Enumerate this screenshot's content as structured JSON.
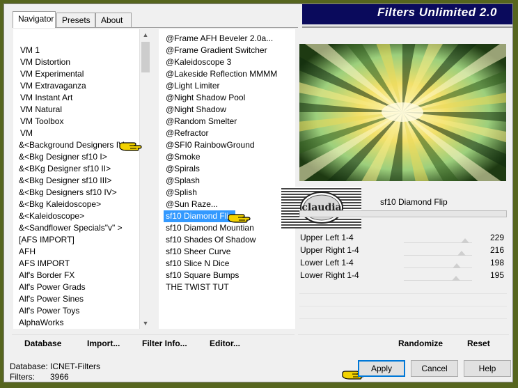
{
  "title": "Filters Unlimited 2.0",
  "tabs": [
    {
      "label": "Navigator",
      "active": true
    },
    {
      "label": "Presets",
      "active": false
    },
    {
      "label": "About",
      "active": false
    }
  ],
  "categories": [
    "VM 1",
    "VM Distortion",
    "VM Experimental",
    "VM Extravaganza",
    "VM Instant Art",
    "VM Natural",
    "VM Toolbox",
    "VM",
    "&<Background Designers IV>",
    "&<Bkg Designer sf10 I>",
    "&<BKg Designer sf10 II>",
    "&<Bkg Designer sf10 III>",
    "&<Bkg Designers sf10 IV>",
    "&<Bkg Kaleidoscope>",
    "&<Kaleidoscope>",
    "&<Sandflower Specials\"v\" >",
    "[AFS IMPORT]",
    "AFH",
    "AFS IMPORT",
    "Alf's Border FX",
    "Alf's Power Grads",
    "Alf's Power Sines",
    "Alf's Power Toys",
    "AlphaWorks"
  ],
  "filters": [
    "@Frame AFH Beveler 2.0a...",
    "@Frame Gradient Switcher",
    "@Kaleidoscope 3",
    "@Lakeside Reflection MMMM",
    "@Light Limiter",
    "@Night Shadow Pool",
    "@Night Shadow",
    "@Random Smelter",
    "@Refractor",
    "@SFI0 RainbowGround",
    "@Smoke",
    "@Spirals",
    "@Splash",
    "@Splish",
    "@Sun Raze...",
    "sf10 Diamond Flip",
    "sf10 Diamond Mountian",
    "sf10 Shades Of Shadow",
    "sf10 Sheer Curve",
    "sf10 Slice N Dice",
    "sf10 Square Bumps",
    "THE TWIST TUT"
  ],
  "selected_category_index": 8,
  "selected_filter_index": 15,
  "filter_name": "sf10 Diamond Flip",
  "logo_text": "claudia",
  "params": [
    {
      "label": "Upper Left 1-4",
      "value": "229",
      "level": 229
    },
    {
      "label": "Upper Right 1-4",
      "value": "216",
      "level": 216
    },
    {
      "label": "Lower Left 1-4",
      "value": "198",
      "level": 198
    },
    {
      "label": "Lower Right 1-4",
      "value": "195",
      "level": 195
    }
  ],
  "toolbar": {
    "database": "Database",
    "import": "Import...",
    "filter_info": "Filter Info...",
    "editor": "Editor...",
    "randomize": "Randomize",
    "reset": "Reset"
  },
  "status": {
    "database_label": "Database:",
    "database_value": "ICNET-Filters",
    "filters_label": "Filters:",
    "filters_value": "3966"
  },
  "buttons": {
    "apply": "Apply",
    "cancel": "Cancel",
    "help": "Help"
  },
  "colors": {
    "frame": "#56651e",
    "banner": "#0a0a5c",
    "selection": "#3399ff",
    "pointer_hand": "#f2d200"
  }
}
